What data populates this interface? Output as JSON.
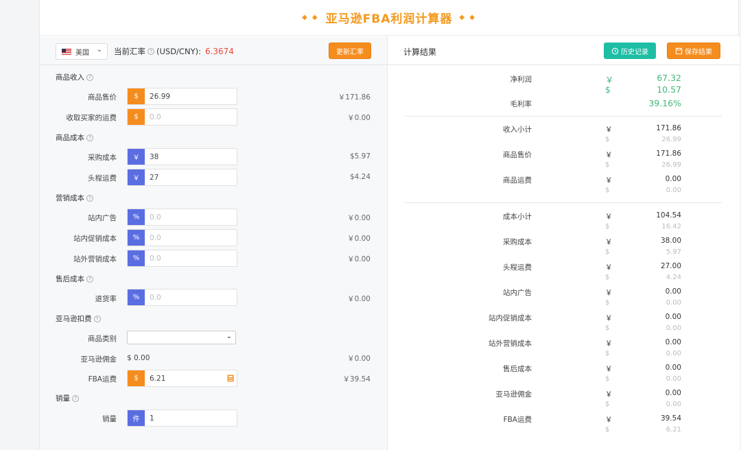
{
  "header": {
    "deco_left": "◆ ◆",
    "deco_right": "◆ ◆",
    "title": "亚马逊FBA利润计算器"
  },
  "toolbar": {
    "country": "美国",
    "rate_label": "当前汇率",
    "rate_unit": "(USD/CNY):",
    "rate_value": "6.3674",
    "update_button": "更新汇率"
  },
  "colors": {
    "orange": "#f58d1e",
    "blue": "#5b6ee1",
    "teal": "#1ebea5",
    "green": "#41b87a",
    "red": "#e5483a"
  },
  "left": {
    "income": {
      "title": "商品收入",
      "price": {
        "label": "商品售价",
        "prefix": "$",
        "value": "26.99",
        "amount": "￥171.86"
      },
      "shipping": {
        "label": "收取买家的运费",
        "prefix": "$",
        "placeholder": "0.0",
        "amount": "￥0.00"
      }
    },
    "cost": {
      "title": "商品成本",
      "purchase": {
        "label": "采购成本",
        "prefix": "￥",
        "value": "38",
        "amount": "$5.97"
      },
      "headway": {
        "label": "头程运费",
        "prefix": "￥",
        "value": "27",
        "amount": "$4.24"
      }
    },
    "marketing": {
      "title": "营销成本",
      "ads": {
        "label": "站内广告",
        "prefix": "%",
        "placeholder": "0.0",
        "amount": "￥0.00"
      },
      "promo": {
        "label": "站内促销成本",
        "prefix": "%",
        "placeholder": "0.0",
        "amount": "￥0.00"
      },
      "external": {
        "label": "站外营销成本",
        "prefix": "%",
        "placeholder": "0.0",
        "amount": "￥0.00"
      }
    },
    "aftersale": {
      "title": "售后成本",
      "return": {
        "label": "退货率",
        "prefix": "%",
        "placeholder": "0.0",
        "amount": "￥0.00"
      }
    },
    "fees": {
      "title": "亚马逊扣费",
      "category": {
        "label": "商品类别",
        "value": ""
      },
      "commission": {
        "label": "亚马逊佣金",
        "value": "$ 0.00",
        "amount": "￥0.00"
      },
      "fba": {
        "label": "FBA运费",
        "prefix": "$",
        "value": "6.21",
        "amount": "￥39.54"
      }
    },
    "sales": {
      "title": "销量",
      "qty": {
        "label": "销量",
        "prefix": "件",
        "value": "1"
      }
    }
  },
  "right": {
    "title": "计算结果",
    "history_button": "历史记录",
    "save_button": "保存结果",
    "profit": {
      "label": "净利润",
      "cny": "67.32",
      "usd": "10.57"
    },
    "margin": {
      "label": "毛利率",
      "value": "39.16%"
    },
    "rows1": [
      {
        "label": "收入小计",
        "cny": "171.86",
        "usd": "26.99"
      },
      {
        "label": "商品售价",
        "cny": "171.86",
        "usd": "26.99"
      },
      {
        "label": "商品运费",
        "cny": "0.00",
        "usd": "0.00"
      }
    ],
    "rows2": [
      {
        "label": "成本小计",
        "cny": "104.54",
        "usd": "16.42"
      },
      {
        "label": "采购成本",
        "cny": "38.00",
        "usd": "5.97"
      },
      {
        "label": "头程运费",
        "cny": "27.00",
        "usd": "4.24"
      },
      {
        "label": "站内广告",
        "cny": "0.00",
        "usd": "0.00"
      },
      {
        "label": "站内促销成本",
        "cny": "0.00",
        "usd": "0.00"
      },
      {
        "label": "站外营销成本",
        "cny": "0.00",
        "usd": "0.00"
      },
      {
        "label": "售后成本",
        "cny": "0.00",
        "usd": "0.00"
      },
      {
        "label": "亚马逊佣金",
        "cny": "0.00",
        "usd": "0.00"
      },
      {
        "label": "FBA运费",
        "cny": "39.54",
        "usd": "6.21"
      }
    ],
    "cny_sym": "￥",
    "usd_sym": "$"
  }
}
